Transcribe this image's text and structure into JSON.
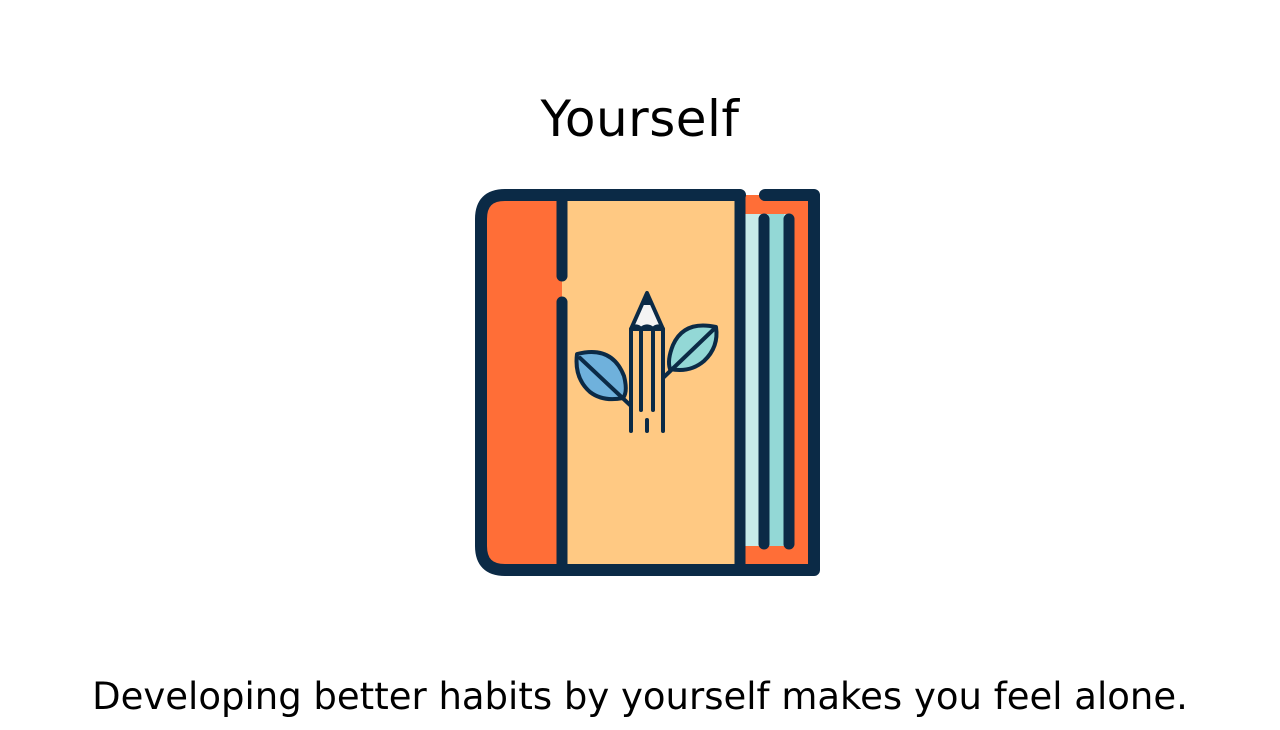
{
  "page": {
    "title": "Yourself",
    "caption": "Developing better habits by yourself makes you feel alone."
  },
  "illustration": {
    "icon": "journal-notebook-with-pencil-and-leaves-icon",
    "colors": {
      "outline": "#0b2a46",
      "cover": "#ff6e37",
      "page": "#ffc983",
      "page_edges": "#93d8d6",
      "page_edges_light": "#c7ebe9",
      "leaf": "#6fb1dc",
      "leaf_right": "#93d8d6",
      "pencil_tip": "#f4f4f4"
    }
  }
}
